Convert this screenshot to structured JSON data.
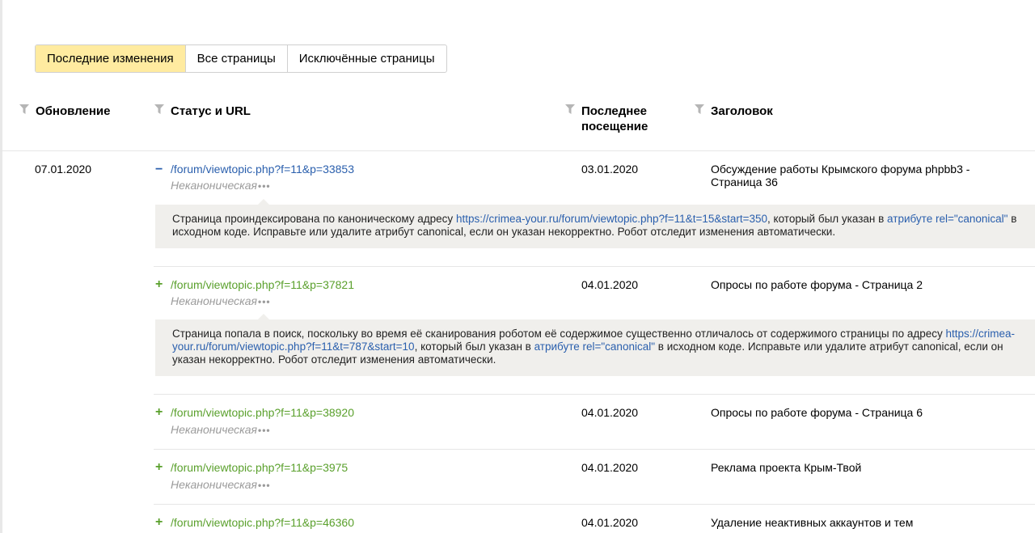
{
  "tabs": [
    "Последние изменения",
    "Все страницы",
    "Исключённые страницы"
  ],
  "columns": {
    "update": "Обновление",
    "status_url": "Статус и URL",
    "last_visit_line1": "Последнее",
    "last_visit_line2": "посещение",
    "title": "Заголовок"
  },
  "group_date": "07.01.2020",
  "rows": [
    {
      "sign": "−",
      "url": "/forum/viewtopic.php?f=11&p=33853",
      "status": "Неканоническая",
      "visit": "03.01.2020",
      "title": "Обсуждение работы Крымского форума phpbb3 - Страница 36",
      "note": {
        "t1": "Страница проиндексирована по каноническому адресу ",
        "link1": "https://crimea-your.ru/forum/viewtopic.php?f=11&t=15&start=350",
        "t2": ", который был указан в ",
        "link2": "атрибуте rel=\"canonical\"",
        "t3": " в исходном коде. Исправьте или удалите атрибут canonical, если он указан некорректно. Робот отследит изменения автоматически."
      }
    },
    {
      "sign": "+",
      "url": "/forum/viewtopic.php?f=11&p=37821",
      "status": "Неканоническая",
      "visit": "04.01.2020",
      "title": "Опросы по работе форума - Страница 2",
      "note": {
        "t1": "Страница попала в поиск, поскольку во время её сканирования роботом её содержимое существенно отличалось от содержимого страницы по адресу ",
        "link1": "https://crimea-your.ru/forum/viewtopic.php?f=11&t=787&start=10",
        "t2": ", который был указан в ",
        "link2": "атрибуте rel=\"canonical\"",
        "t3": " в исходном коде. Исправьте или удалите атрибут canonical, если он указан некорректно. Робот отследит изменения автоматически."
      }
    },
    {
      "sign": "+",
      "url": "/forum/viewtopic.php?f=11&p=38920",
      "status": "Неканоническая",
      "visit": "04.01.2020",
      "title": "Опросы по работе форума - Страница 6"
    },
    {
      "sign": "+",
      "url": "/forum/viewtopic.php?f=11&p=3975",
      "status": "Неканоническая",
      "visit": "04.01.2020",
      "title": "Реклама проекта Крым-Твой"
    },
    {
      "sign": "+",
      "url": "/forum/viewtopic.php?f=11&p=46360",
      "status": "",
      "visit": "04.01.2020",
      "title": "Удаление неактивных аккаунтов и тем"
    }
  ],
  "dots_label": "•••",
  "colors": {
    "tab_active": "#ffeba0",
    "link_blue": "#2a5fad",
    "link_green": "#5aa02c",
    "note_bg": "#f0efec",
    "muted": "#9b9b9b"
  }
}
